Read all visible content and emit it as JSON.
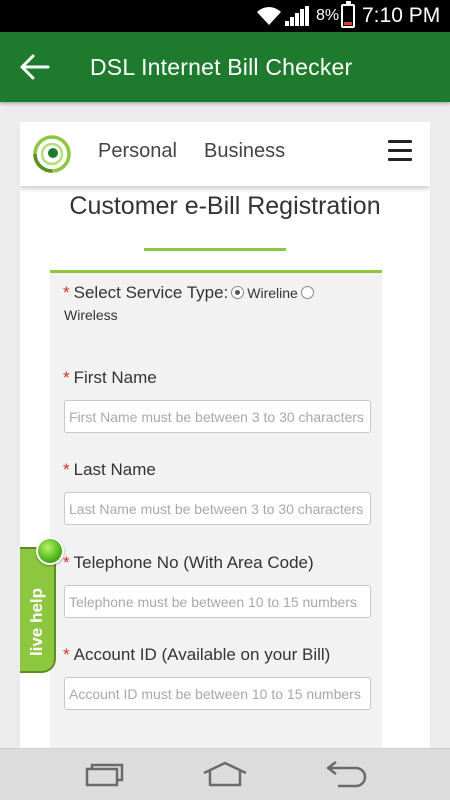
{
  "status_bar": {
    "battery_percent": "8%",
    "time": "7:10 PM",
    "icons": [
      "wifi-icon",
      "signal-icon",
      "battery-icon"
    ]
  },
  "app_bar": {
    "back_icon": "arrow-left-icon",
    "title": "DSL Internet Bill Checker",
    "color": "#1e7a2c"
  },
  "site_header": {
    "logo": "circle-logo-icon",
    "nav": [
      "Personal",
      "Business"
    ],
    "menu_icon": "hamburger-menu-icon"
  },
  "page": {
    "heading": "Customer e-Bill Registration",
    "accent_color": "#8dc63f"
  },
  "form": {
    "required_marker": "*",
    "service_type": {
      "label": "Select Service Type:",
      "options": [
        "Wireline",
        "Wireless"
      ],
      "selected": "Wireline"
    },
    "first_name": {
      "label": "First Name",
      "placeholder": "First Name must be between 3 to 30 characters",
      "value": ""
    },
    "last_name": {
      "label": "Last Name",
      "placeholder": "Last Name must be between 3 to 30 characters",
      "value": ""
    },
    "telephone": {
      "label": "Telephone No (With Area Code)",
      "placeholder": "Telephone must be between 10 to 15 numbers",
      "value": ""
    },
    "account_id": {
      "label": "Account ID (Available on your Bill)",
      "placeholder": "Account ID must be between 10 to 15 numbers",
      "value": ""
    }
  },
  "live_help": {
    "label": "live help"
  },
  "nav_bar": {
    "buttons": [
      "recent-apps-icon",
      "home-icon",
      "back-icon"
    ]
  }
}
